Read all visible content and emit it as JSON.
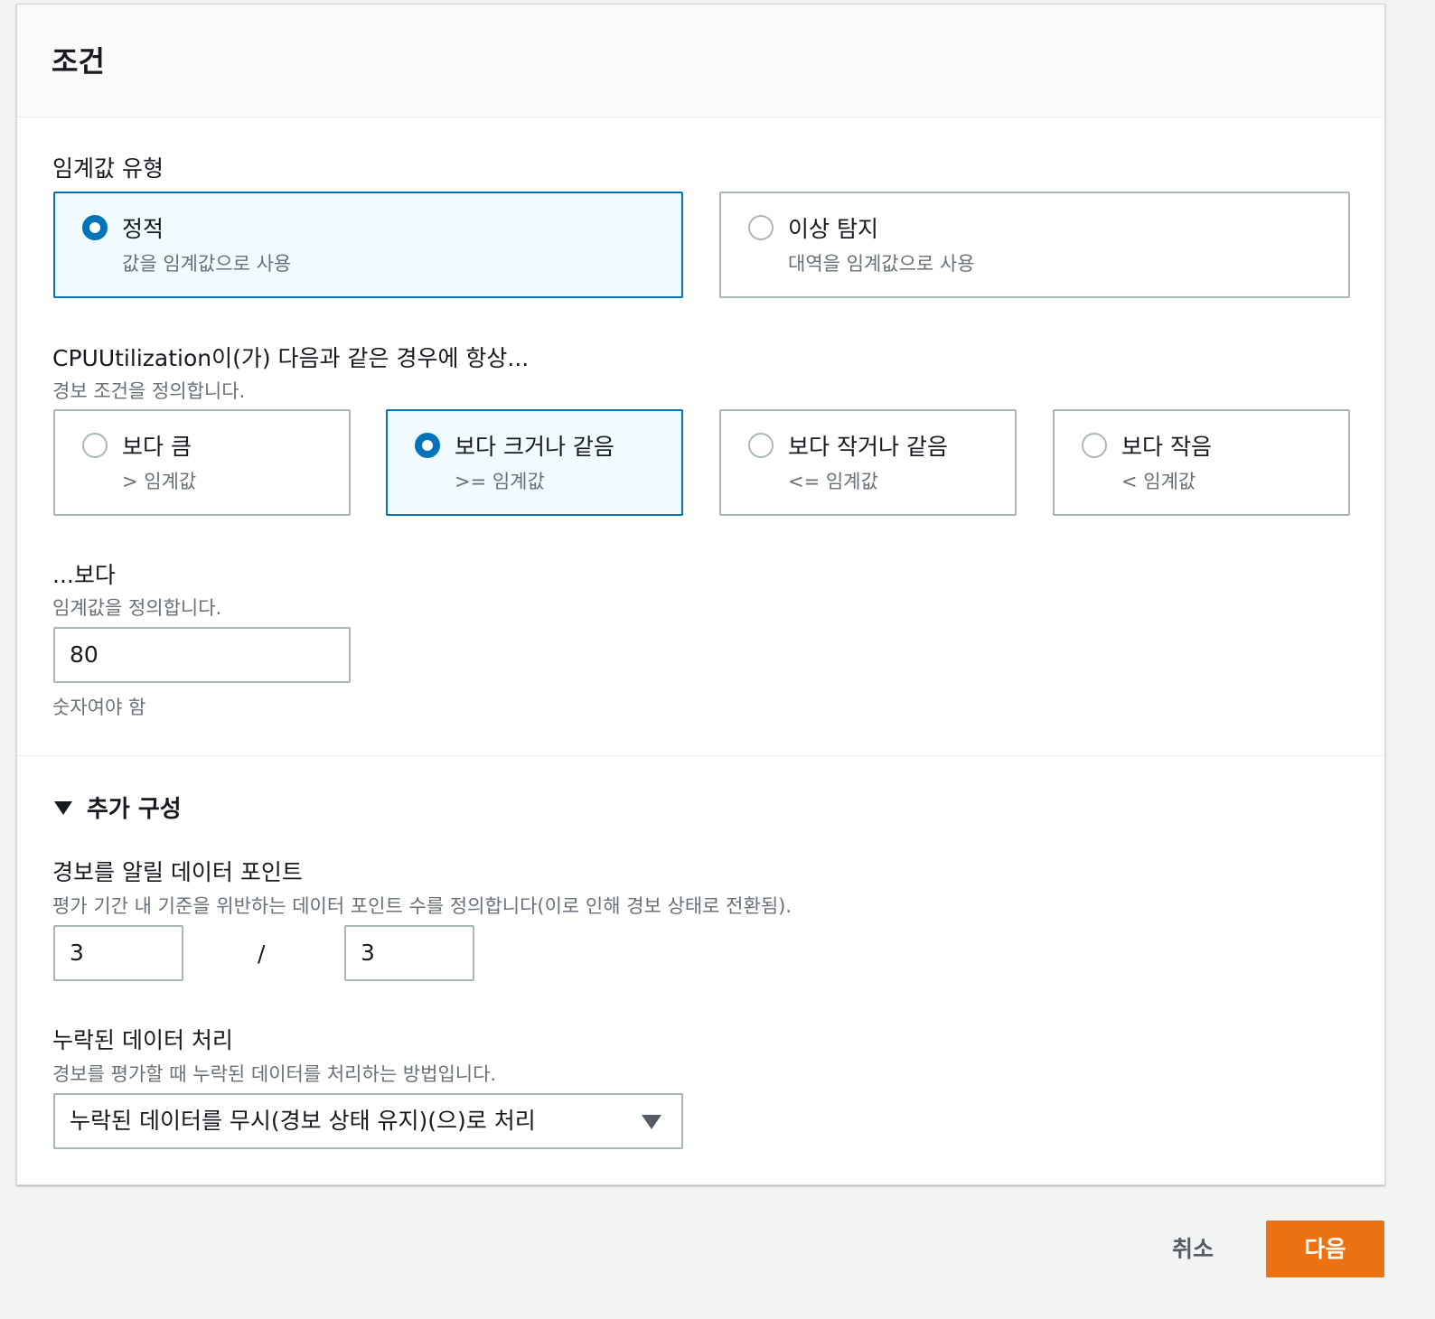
{
  "panel": {
    "title": "조건"
  },
  "threshold_type": {
    "label": "임계값 유형",
    "options": [
      {
        "title": "정적",
        "sub": "값을 임계값으로 사용",
        "selected": true
      },
      {
        "title": "이상 탐지",
        "sub": "대역을 임계값으로 사용",
        "selected": false
      }
    ]
  },
  "condition": {
    "label": "CPUUtilization이(가) 다음과 같은 경우에 항상...",
    "desc": "경보 조건을 정의합니다.",
    "options": [
      {
        "title": "보다 큼",
        "sub": "> 임계값",
        "selected": false
      },
      {
        "title": "보다 크거나 같음",
        "sub": ">= 임계값",
        "selected": true
      },
      {
        "title": "보다 작거나 같음",
        "sub": "<= 임계값",
        "selected": false
      },
      {
        "title": "보다 작음",
        "sub": "< 임계값",
        "selected": false
      }
    ]
  },
  "threshold": {
    "label": "...보다",
    "desc": "임계값을 정의합니다.",
    "value": "80",
    "hint": "숫자여야 함"
  },
  "additional": {
    "toggle_label": "추가 구성",
    "expanded": true,
    "datapoints": {
      "label": "경보를 알릴 데이터 포인트",
      "desc": "평가 기간 내 기준을 위반하는 데이터 포인트 수를 정의합니다(이로 인해 경보 상태로 전환됨).",
      "value_a": "3",
      "separator": "/",
      "value_b": "3"
    },
    "missing_data": {
      "label": "누락된 데이터 처리",
      "desc": "경보를 평가할 때 누락된 데이터를 처리하는 방법입니다.",
      "selected": "누락된 데이터를 무시(경보 상태 유지)(으)로 처리"
    }
  },
  "footer": {
    "cancel": "취소",
    "next": "다음"
  },
  "colors": {
    "accent": "#0073bb",
    "primary_button": "#ec7211"
  }
}
